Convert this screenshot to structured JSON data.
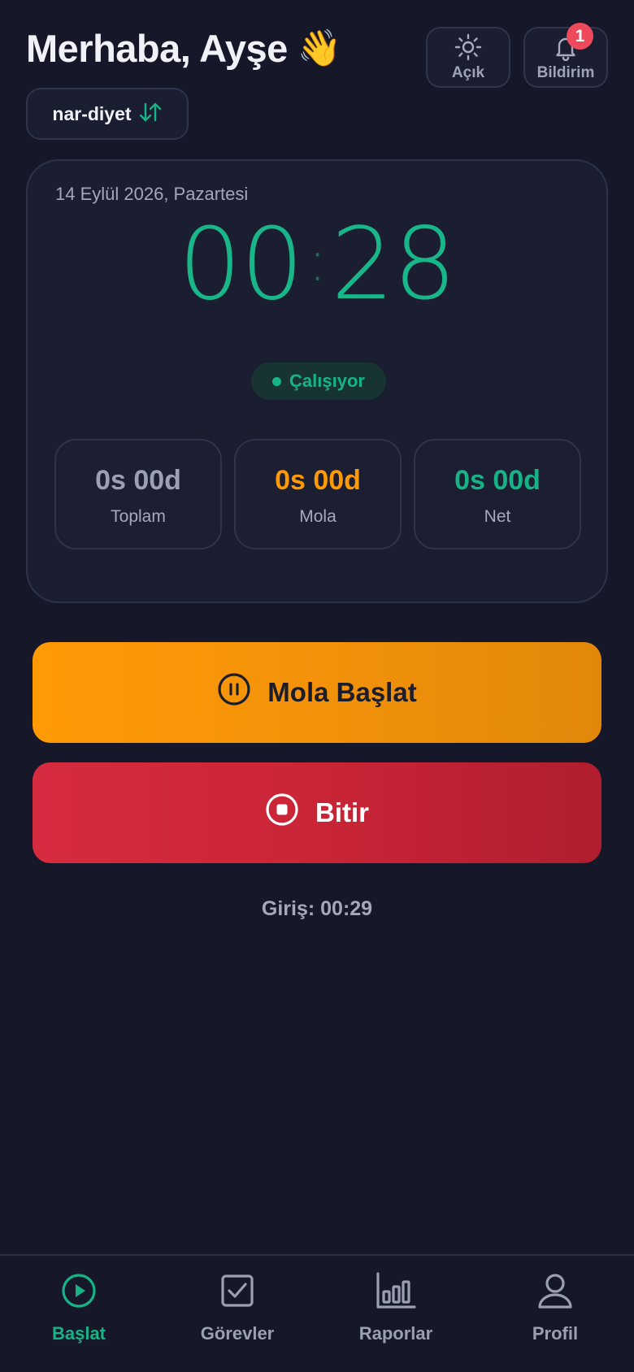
{
  "header": {
    "greeting": "Merhaba, Ayşe",
    "greeting_emoji": "👋",
    "theme_label": "Açık",
    "notifications_label": "Bildirim",
    "notification_count": "1"
  },
  "project": {
    "name": "nar-diyet",
    "switch_icon": "swap-vertical-icon"
  },
  "timer_card": {
    "date": "14 Eylül 2026, Pazartesi",
    "minutes": "00",
    "separator": ":",
    "seconds": "28",
    "status": "Çalışıyor",
    "stats": {
      "total": {
        "value": "0s 00d",
        "label": "Toplam"
      },
      "break": {
        "value": "0s 00d",
        "label": "Mola"
      },
      "net": {
        "value": "0s 00d",
        "label": "Net"
      }
    }
  },
  "actions": {
    "break_label": "Mola Başlat",
    "finish_label": "Bitir",
    "checkin_text": "Giriş: 00:29"
  },
  "nav": {
    "items": [
      {
        "label": "Başlat",
        "icon": "play-circle-icon",
        "active": true
      },
      {
        "label": "Görevler",
        "icon": "checkbox-icon",
        "active": false
      },
      {
        "label": "Raporlar",
        "icon": "bar-chart-icon",
        "active": false
      },
      {
        "label": "Profil",
        "icon": "user-icon",
        "active": false
      }
    ]
  },
  "colors": {
    "background": "#161829",
    "card": "#1b1d30",
    "accent_green": "#17b387",
    "accent_orange": "#ff9a05",
    "accent_red": "#d72b40",
    "muted_text": "#a4a8ba",
    "badge_red": "#ef4a5b"
  }
}
